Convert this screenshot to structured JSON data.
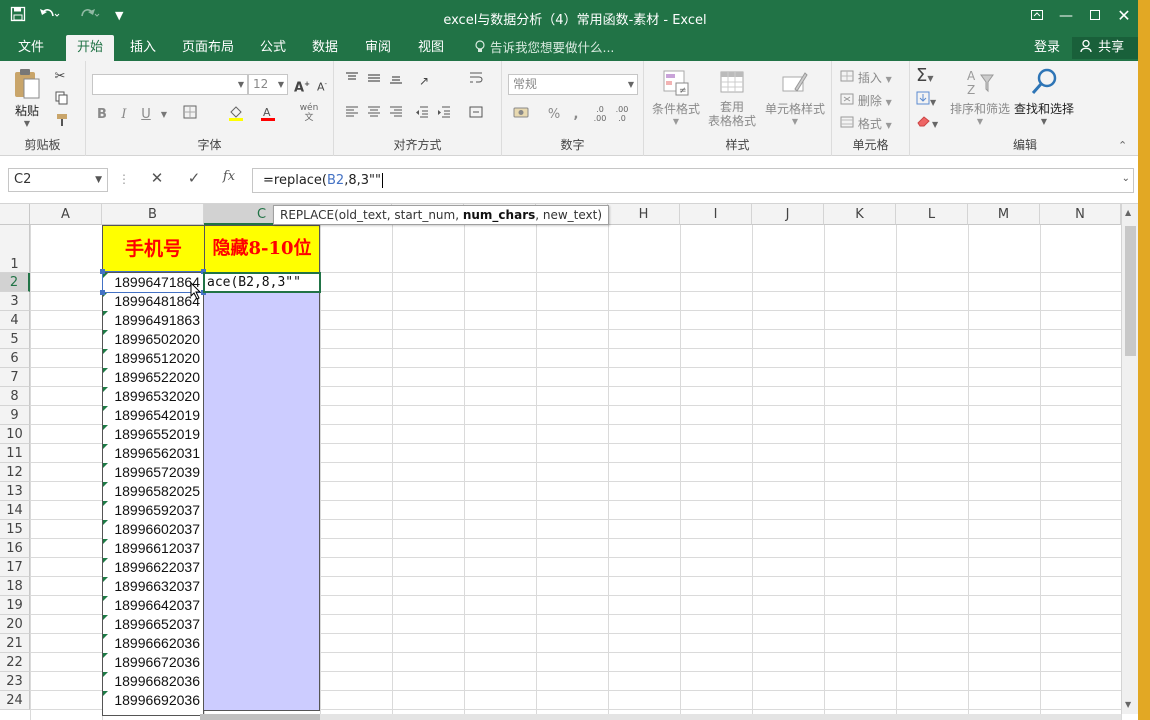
{
  "window": {
    "title": "excel与数据分析（4）常用函数-素材 - Excel"
  },
  "tabs": [
    {
      "label": "文件",
      "active": false
    },
    {
      "label": "开始",
      "active": true
    },
    {
      "label": "插入",
      "active": false
    },
    {
      "label": "页面布局",
      "active": false
    },
    {
      "label": "公式",
      "active": false
    },
    {
      "label": "数据",
      "active": false
    },
    {
      "label": "审阅",
      "active": false
    },
    {
      "label": "视图",
      "active": false
    }
  ],
  "tellme": "告诉我您想要做什么...",
  "account": {
    "login": "登录",
    "share": "共享"
  },
  "ribbon": {
    "clipboard": {
      "paste": "粘贴",
      "label": "剪贴板"
    },
    "font": {
      "size": "12",
      "bold": "B",
      "italic": "I",
      "underline": "U",
      "label": "字体"
    },
    "alignment": {
      "label": "对齐方式"
    },
    "number": {
      "format": "常规",
      "label": "数字"
    },
    "styles": {
      "conditional": "条件格式",
      "table_format_1": "套用",
      "table_format_2": "表格格式",
      "cell_style": "单元格样式",
      "label": "样式"
    },
    "cells": {
      "insert": "插入",
      "delete": "删除",
      "format": "格式",
      "label": "单元格"
    },
    "editing": {
      "sort": "排序和筛选",
      "find": "查找和选择",
      "label": "编辑"
    }
  },
  "formula_bar": {
    "name_box": "C2",
    "fx": "fx",
    "formula_prefix": "=replace(",
    "formula_ref": "B2",
    "formula_suffix": ",8,3\"\""
  },
  "tooltip": {
    "prefix": "REPLACE(old_text, start_num, ",
    "bold": "num_chars",
    "suffix": ", new_text)"
  },
  "columns": [
    "A",
    "B",
    "C",
    "H",
    "I",
    "J",
    "K",
    "L",
    "M",
    "N"
  ],
  "row_numbers": [
    "1",
    "2",
    "3",
    "4",
    "5",
    "6",
    "7",
    "8",
    "9",
    "10",
    "11",
    "12",
    "13",
    "14",
    "15",
    "16",
    "17",
    "18",
    "19",
    "20",
    "21",
    "22",
    "23",
    "24"
  ],
  "header_cells": {
    "b1": "手机号",
    "c1": "隐藏8-10位"
  },
  "phones": [
    "18996471864",
    "18996481864",
    "18996491863",
    "18996502020",
    "18996512020",
    "18996522020",
    "18996532020",
    "18996542019",
    "18996552019",
    "18996562031",
    "18996572039",
    "18996582025",
    "18996592037",
    "18996602037",
    "18996612037",
    "18996622037",
    "18996632037",
    "18996642037",
    "18996652037",
    "18996662036",
    "18996672036",
    "18996682036",
    "18996692036"
  ],
  "active_cell_text": "ace(B2,8,3\"\""
}
